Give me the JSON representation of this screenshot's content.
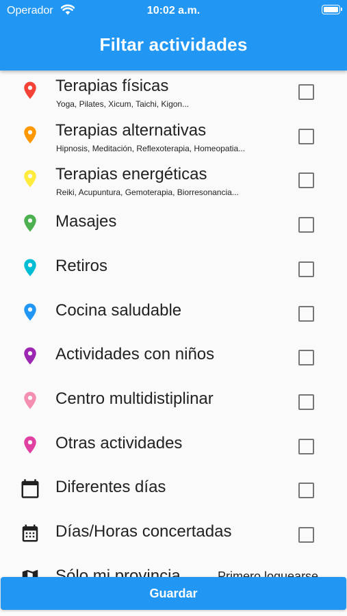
{
  "status_bar": {
    "carrier": "Operador",
    "time": "10:02 a.m."
  },
  "header": {
    "title": "Filtar actividades"
  },
  "items": [
    {
      "label": "Terapias físicas",
      "subtitle": "Yoga, Pilates, Xicum, Taichi, Kigon...",
      "color": "#f44336",
      "icon": "location-pin-icon",
      "checked": false
    },
    {
      "label": "Terapias alternativas",
      "subtitle": "Hipnosis, Meditación, Reflexoterapia, Homeopatia...",
      "color": "#ff9800",
      "icon": "location-pin-icon",
      "checked": false
    },
    {
      "label": "Terapias energéticas",
      "subtitle": "Reiki, Acupuntura, Gemoterapia, Biorresonancia...",
      "color": "#ffeb3b",
      "icon": "location-pin-icon",
      "checked": false
    },
    {
      "label": "Masajes",
      "color": "#4caf50",
      "icon": "location-pin-icon",
      "checked": false
    },
    {
      "label": "Retiros",
      "color": "#00bcd4",
      "icon": "location-pin-icon",
      "checked": false
    },
    {
      "label": "Cocina saludable",
      "color": "#2196f3",
      "icon": "location-pin-icon",
      "checked": false
    },
    {
      "label": "Actividades con niños",
      "color": "#9c27b0",
      "icon": "location-pin-icon",
      "checked": false
    },
    {
      "label": "Centro multidistiplinar",
      "color": "#f48fb1",
      "icon": "location-pin-icon",
      "checked": false
    },
    {
      "label": "Otras actividades",
      "color": "#e040a0",
      "icon": "location-pin-icon",
      "checked": false
    },
    {
      "label": "Diferentes días",
      "color": "#212121",
      "icon": "calendar-icon",
      "checked": false
    },
    {
      "label": "Días/Horas concertadas",
      "color": "#212121",
      "icon": "calendar-grid-icon",
      "checked": false
    },
    {
      "label": "Sólo mi provincia",
      "color": "#212121",
      "icon": "map-icon",
      "trailing": "Primero loguearse"
    }
  ],
  "actions": {
    "save_label": "Guardar"
  }
}
